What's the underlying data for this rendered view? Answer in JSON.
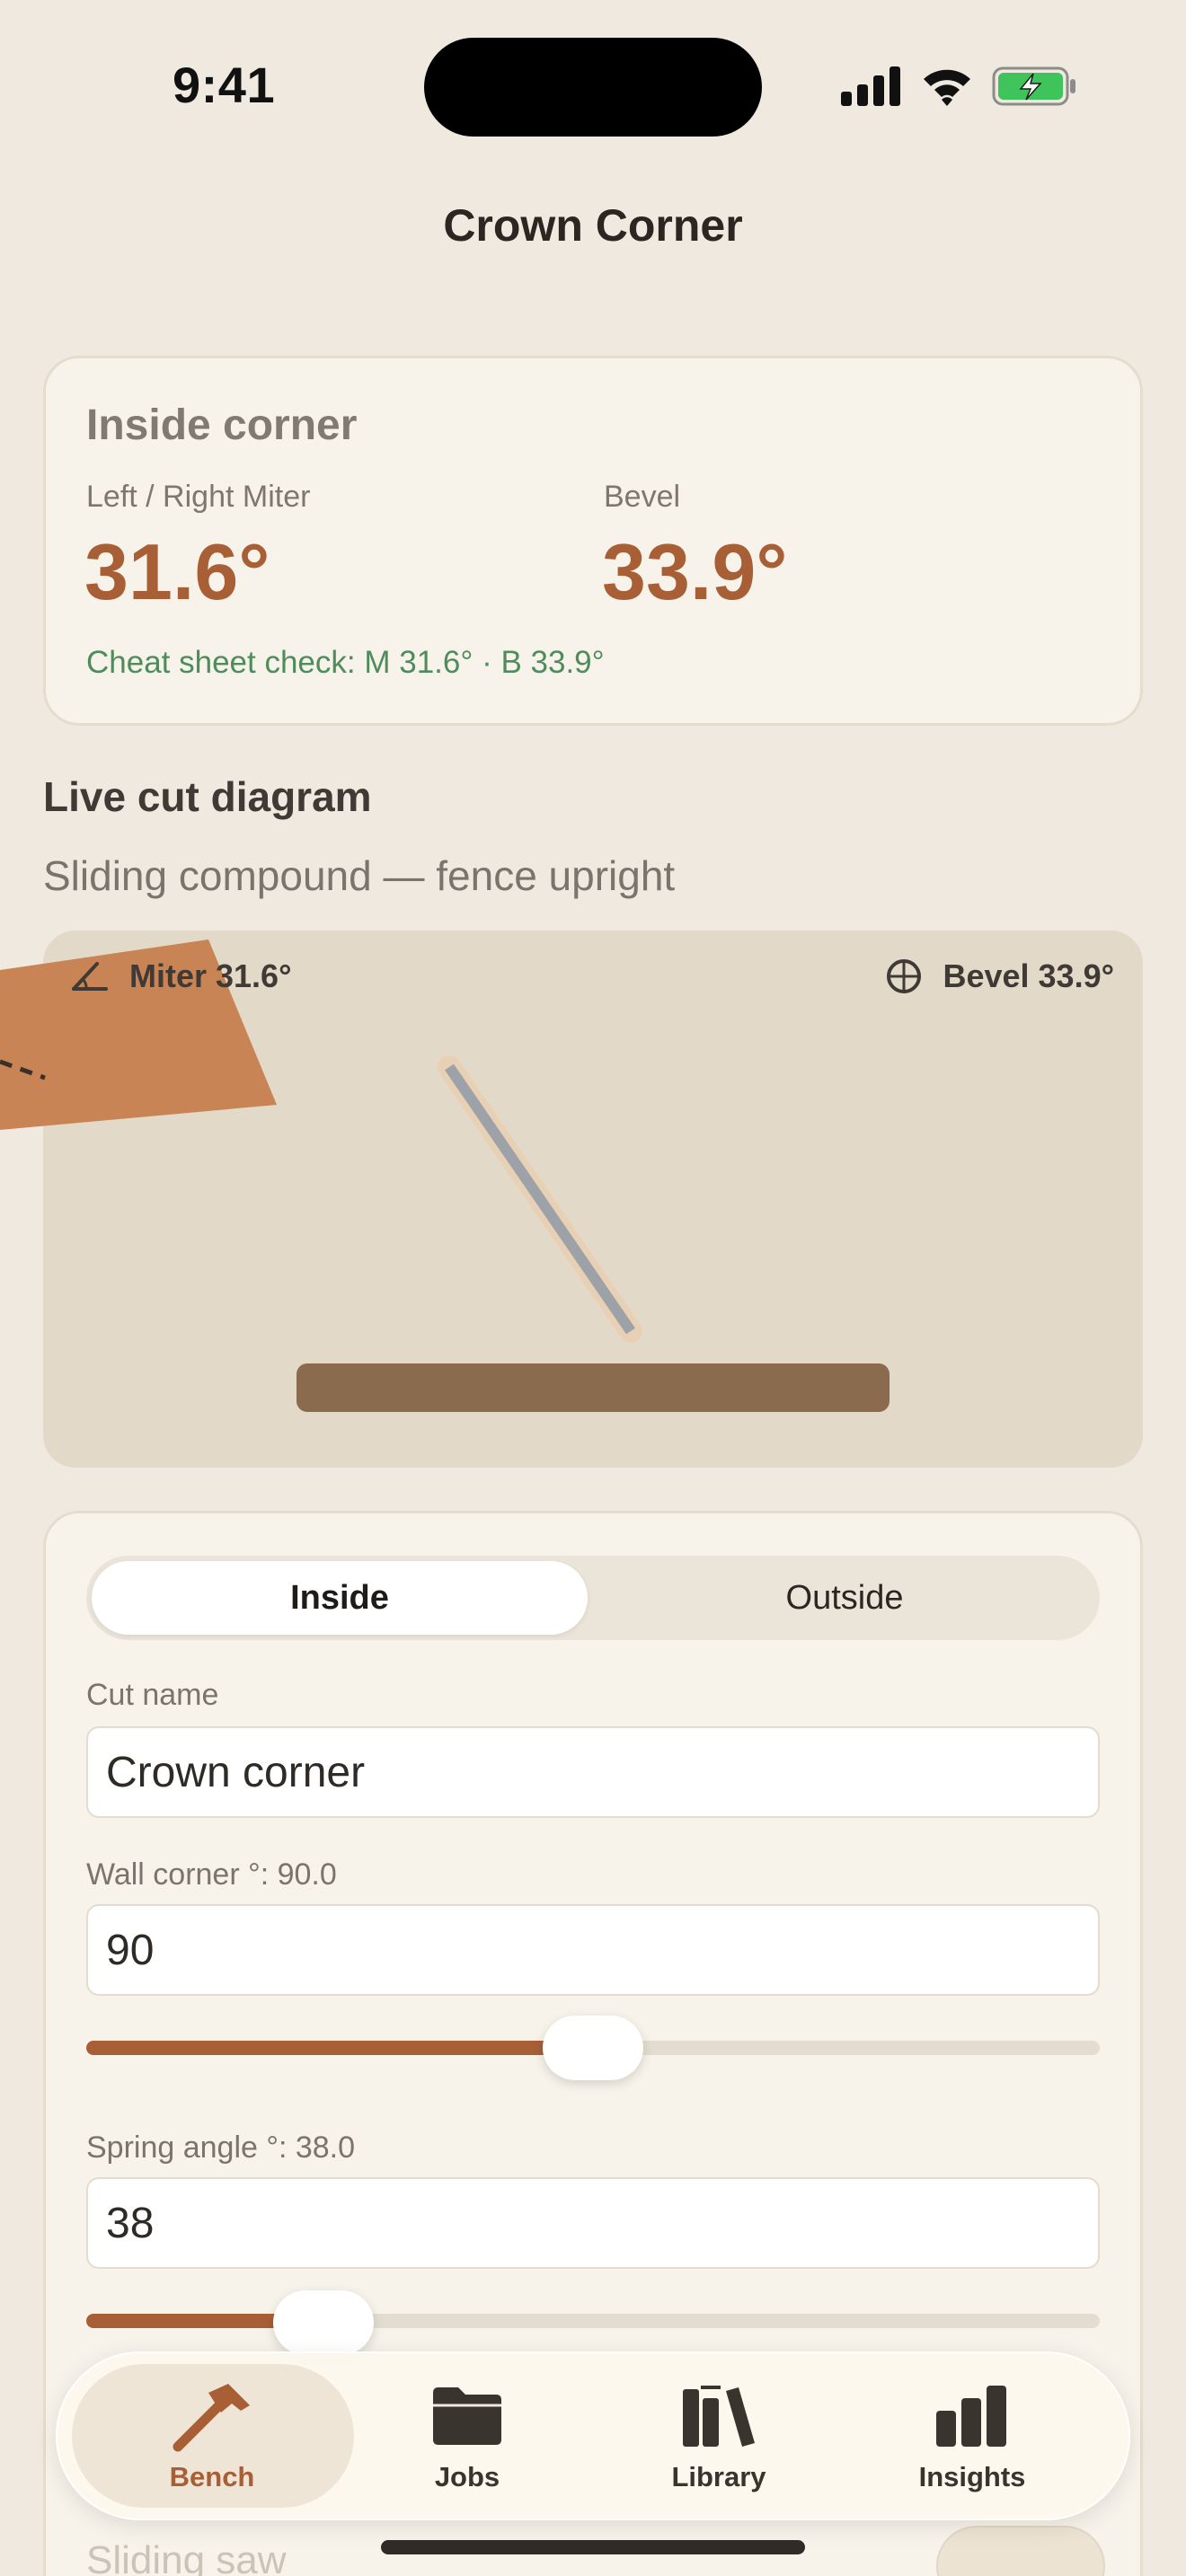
{
  "status_bar": {
    "time": "9:41"
  },
  "nav": {
    "title": "Crown Corner"
  },
  "result": {
    "heading": "Inside corner",
    "miter_label": "Left / Right Miter",
    "bevel_label": "Bevel",
    "miter_value": "31.6°",
    "bevel_value": "33.9°",
    "cheat_sheet": "Cheat sheet check: M 31.6° · B 33.9°"
  },
  "diagram": {
    "heading": "Live cut diagram",
    "subtitle": "Sliding compound — fence upright",
    "miter_chip": "Miter 31.6°",
    "bevel_chip": "Bevel 33.9°",
    "icons": {
      "miter": "angle-icon",
      "bevel": "globe-icon"
    }
  },
  "form": {
    "corner_type": {
      "options": [
        "Inside",
        "Outside"
      ],
      "selected": "Inside"
    },
    "cut_name": {
      "label": "Cut name",
      "value": "Crown corner"
    },
    "wall_corner": {
      "label": "Wall corner °: 90.0",
      "value": "90",
      "slider_fraction": 0.5
    },
    "spring_angle": {
      "label": "Spring angle °: 38.0",
      "value": "38",
      "slider_fraction": 0.24
    },
    "sliding_saw": {
      "label": "Sliding saw"
    }
  },
  "tabs": [
    {
      "label": "Bench",
      "icon": "hammer-icon",
      "active": true
    },
    {
      "label": "Jobs",
      "icon": "folder-icon",
      "active": false
    },
    {
      "label": "Library",
      "icon": "books-icon",
      "active": false
    },
    {
      "label": "Insights",
      "icon": "bar-chart-icon",
      "active": false
    }
  ],
  "colors": {
    "accent": "#a85f36",
    "success": "#4f8c5c",
    "background": "#efe9df",
    "card": "#f7f3ea"
  }
}
